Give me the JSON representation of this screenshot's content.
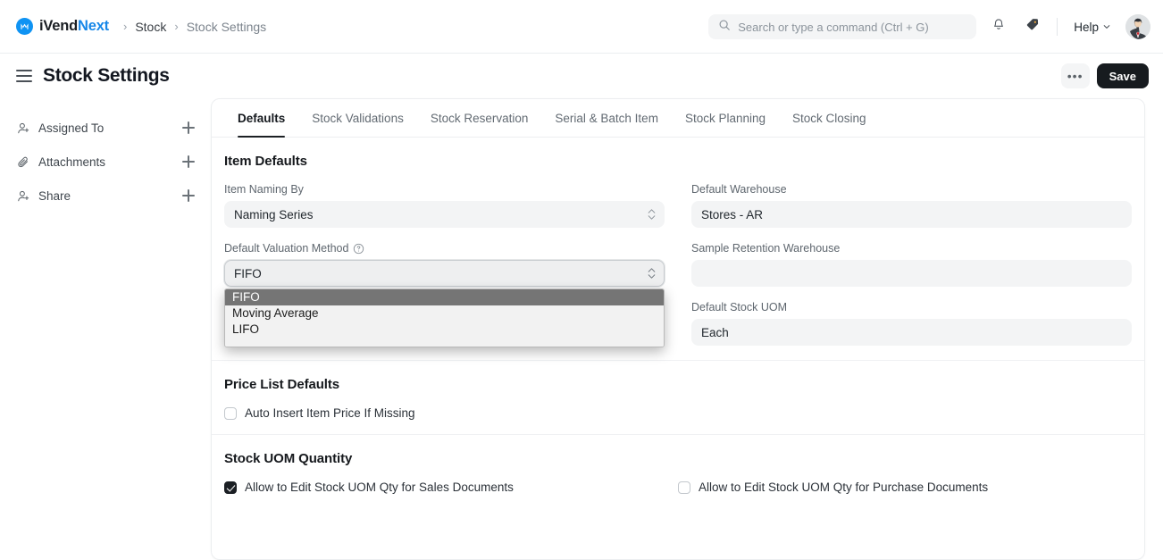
{
  "navbar": {
    "brand_dark": "iVend",
    "brand_blue": "Next",
    "breadcrumbs": [
      {
        "label": "Stock",
        "muted": false
      },
      {
        "label": "Stock Settings",
        "muted": true
      }
    ],
    "separator": "›",
    "search_placeholder": "Search or type a command (Ctrl + G)",
    "search_value": "",
    "help_label": "Help"
  },
  "page": {
    "title": "Stock Settings",
    "more_label": "•••",
    "save_label": "Save"
  },
  "sidebar": {
    "items": [
      {
        "label": "Assigned To",
        "icon": "user-plus-icon"
      },
      {
        "label": "Attachments",
        "icon": "paperclip-icon"
      },
      {
        "label": "Share",
        "icon": "user-plus-icon"
      }
    ]
  },
  "tabs": [
    {
      "label": "Defaults",
      "active": true
    },
    {
      "label": "Stock Validations",
      "active": false
    },
    {
      "label": "Stock Reservation",
      "active": false
    },
    {
      "label": "Serial & Batch Item",
      "active": false
    },
    {
      "label": "Stock Planning",
      "active": false
    },
    {
      "label": "Stock Closing",
      "active": false
    }
  ],
  "sections": {
    "item_defaults": {
      "title": "Item Defaults",
      "item_naming_by": {
        "label": "Item Naming By",
        "value": "Naming Series"
      },
      "default_valuation_method": {
        "label": "Default Valuation Method",
        "value": "FIFO",
        "options": [
          "FIFO",
          "Moving Average",
          "LIFO"
        ],
        "selected_index": 0,
        "open": true
      },
      "default_warehouse": {
        "label": "Default Warehouse",
        "value": "Stores - AR"
      },
      "sample_retention_warehouse": {
        "label": "Sample Retention Warehouse",
        "value": ""
      },
      "default_stock_uom": {
        "label": "Default Stock UOM",
        "value": "Each"
      }
    },
    "price_list_defaults": {
      "title": "Price List Defaults",
      "auto_insert": {
        "label": "Auto Insert Item Price If Missing",
        "checked": false
      }
    },
    "stock_uom_quantity": {
      "title": "Stock UOM Quantity",
      "sales": {
        "label": "Allow to Edit Stock UOM Qty for Sales Documents",
        "checked": true
      },
      "purchase": {
        "label": "Allow to Edit Stock UOM Qty for Purchase Documents",
        "checked": false
      }
    }
  },
  "colors": {
    "brand_blue": "#1787e8",
    "save_dark": "#171b1f",
    "field_bg": "#f3f4f5",
    "dropdown_highlight": "#757575"
  }
}
